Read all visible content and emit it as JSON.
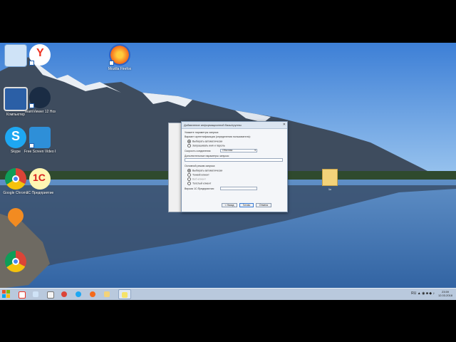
{
  "desktop": {
    "icons": [
      {
        "name": "recycle-bin-icon",
        "label": ""
      },
      {
        "name": "yandex-browser-icon",
        "label": ""
      },
      {
        "name": "firefox-icon",
        "label": "Mozilla Firefox"
      },
      {
        "name": "computer-icon",
        "label": "Компьютер"
      },
      {
        "name": "teamviewer-icon",
        "label": "TeamViewer 12 Host"
      },
      {
        "name": "skype-icon",
        "label": "Skype"
      },
      {
        "name": "screen-recorder-icon",
        "label": "Free Screen Video Recorder"
      },
      {
        "name": "chrome-icon",
        "label": "Google Chrome"
      },
      {
        "name": "1c-icon",
        "label": "1С Предприятие"
      },
      {
        "name": "maps-icon",
        "label": ""
      },
      {
        "name": "chrome-icon-2",
        "label": ""
      }
    ],
    "folder_label": "1с"
  },
  "dialog": {
    "title": "Добавление информационной базы/группы",
    "section1": "Укажите параметры запуска:",
    "auth_label": "Вариант аутентификации (определения пользователя):",
    "auth_opt1": "Выбирать автоматически",
    "auth_opt2": "Запрашивать имя и пароль",
    "speed_label": "Скорость соединения:",
    "speed_value": "Обычная",
    "extra_label": "Дополнительные параметры запуска:",
    "mode_label": "Основной режим запуска:",
    "mode_opt1": "Выбирать автоматически",
    "mode_opt2": "Тонкий клиент",
    "mode_opt3": "Веб-клиент",
    "mode_opt4": "Толстый клиент",
    "version_label": "Версия 1С:Предприятия:",
    "btn_back": "< Назад",
    "btn_finish": "Готово",
    "btn_cancel": "Отмена"
  },
  "taskbar": {
    "tray_lang": "RU",
    "time": "23:59",
    "date": "12.03.2018"
  }
}
